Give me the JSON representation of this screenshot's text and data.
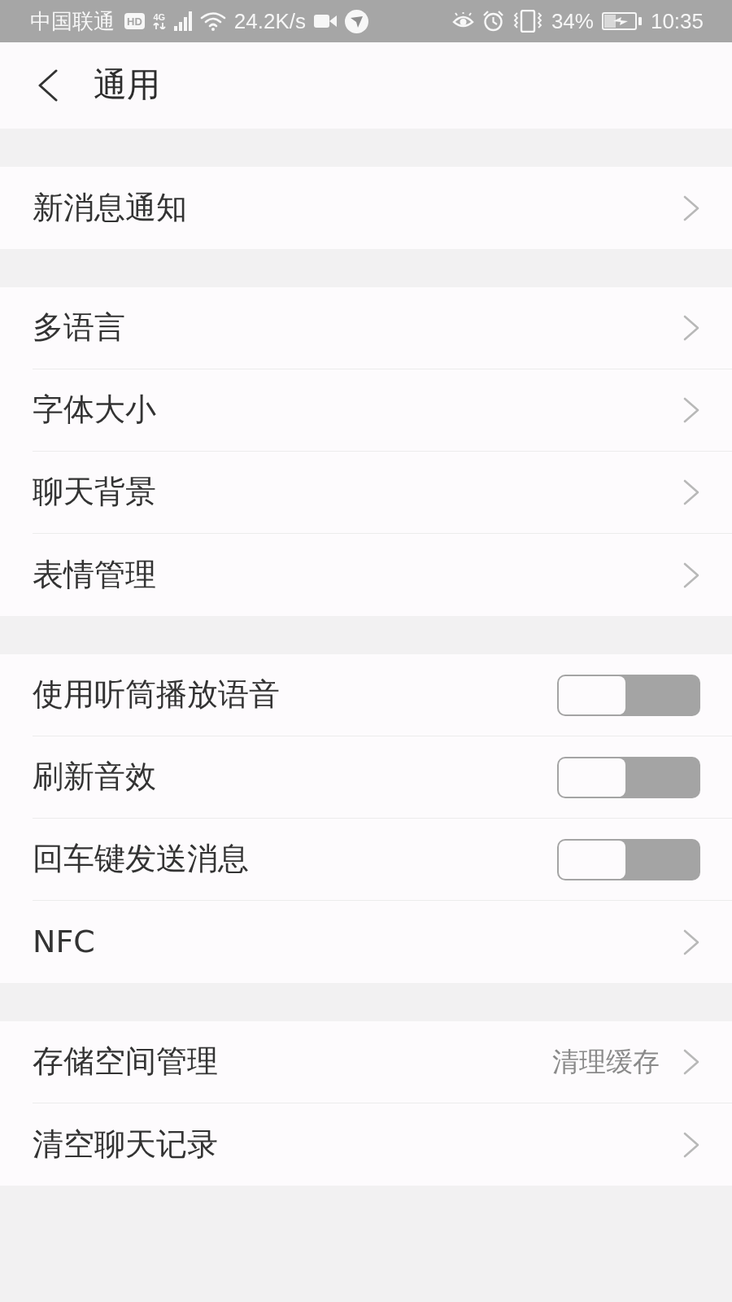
{
  "status_bar": {
    "carrier": "中国联通",
    "hd_badge": "HD",
    "network": "4G",
    "speed": "24.2K/s",
    "battery_percent": "34%",
    "time": "10:35"
  },
  "header": {
    "title": "通用"
  },
  "groups": [
    {
      "items": [
        {
          "kind": "link",
          "label": "新消息通知"
        }
      ]
    },
    {
      "items": [
        {
          "kind": "link",
          "label": "多语言"
        },
        {
          "kind": "link",
          "label": "字体大小"
        },
        {
          "kind": "link",
          "label": "聊天背景"
        },
        {
          "kind": "link",
          "label": "表情管理"
        }
      ]
    },
    {
      "items": [
        {
          "kind": "toggle",
          "label": "使用听筒播放语音",
          "on": false
        },
        {
          "kind": "toggle",
          "label": "刷新音效",
          "on": false
        },
        {
          "kind": "toggle",
          "label": "回车键发送消息",
          "on": false
        },
        {
          "kind": "link",
          "label": "NFC"
        }
      ]
    },
    {
      "items": [
        {
          "kind": "link",
          "label": "存储空间管理",
          "value": "清理缓存"
        },
        {
          "kind": "link",
          "label": "清空聊天记录"
        }
      ]
    }
  ]
}
